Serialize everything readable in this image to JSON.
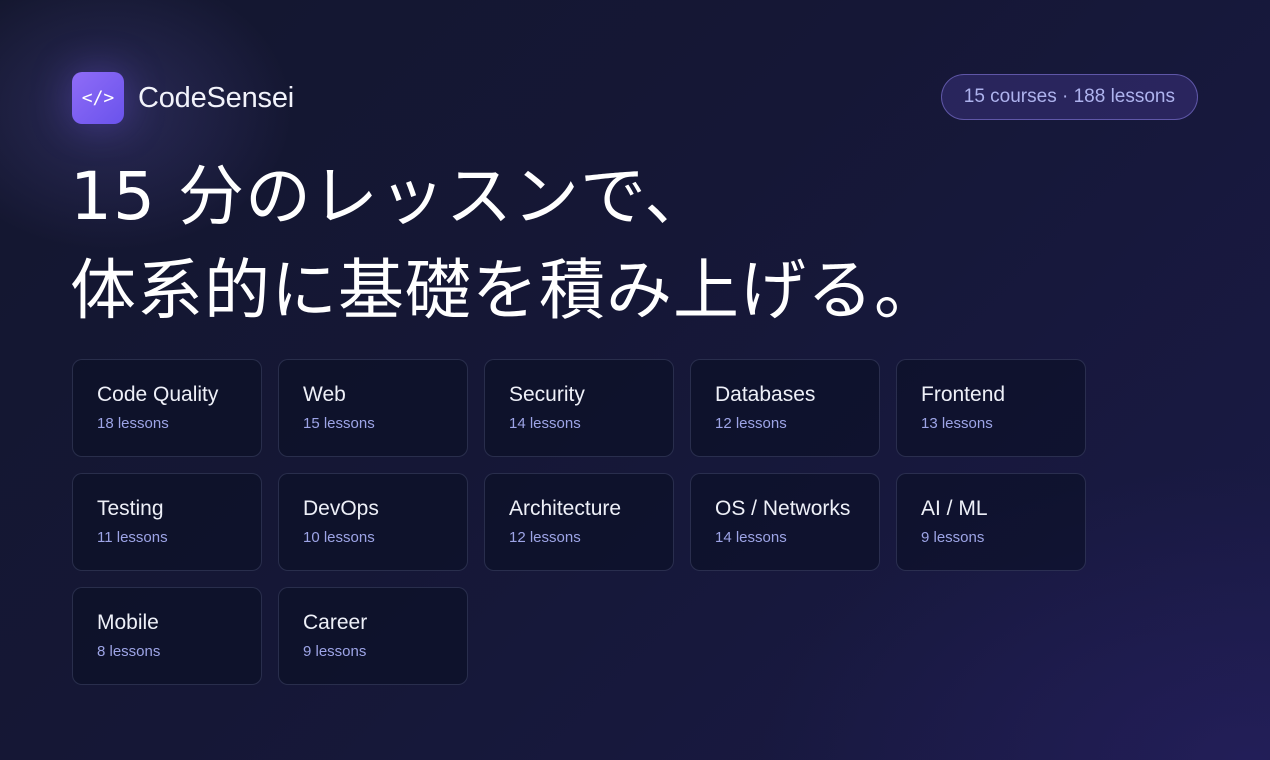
{
  "brand": {
    "logo_icon": "code-brackets-icon",
    "logo_text": "</>",
    "name": "CodeSensei",
    "accent_color": "#7c5cf6"
  },
  "stats": {
    "label": "15 courses · 188 lessons"
  },
  "headline": {
    "line1": "15 分のレッスンで、",
    "line2": "体系的に基礎を積み上げる。"
  },
  "courses": [
    {
      "title": "Code Quality",
      "lessons": "18 lessons"
    },
    {
      "title": "Web",
      "lessons": "15 lessons"
    },
    {
      "title": "Security",
      "lessons": "14 lessons"
    },
    {
      "title": "Databases",
      "lessons": "12 lessons"
    },
    {
      "title": "Frontend",
      "lessons": "13 lessons"
    },
    {
      "title": "Testing",
      "lessons": "11 lessons"
    },
    {
      "title": "DevOps",
      "lessons": "10 lessons"
    },
    {
      "title": "Architecture",
      "lessons": "12 lessons"
    },
    {
      "title": "OS / Networks",
      "lessons": "14 lessons"
    },
    {
      "title": "AI / ML",
      "lessons": "9 lessons"
    },
    {
      "title": "Mobile",
      "lessons": "8 lessons"
    },
    {
      "title": "Career",
      "lessons": "9 lessons"
    }
  ]
}
